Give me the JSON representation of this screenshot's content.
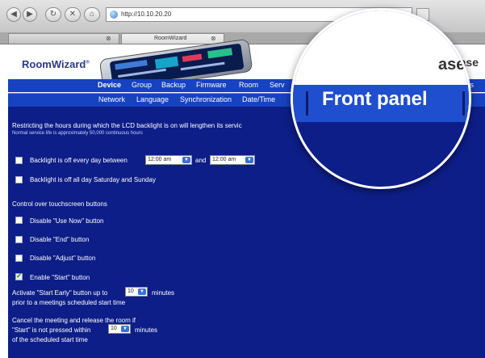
{
  "browser": {
    "url": "http://10.10.20.20",
    "tab_active": "RoomWizard"
  },
  "header": {
    "logo_text": "RoomWizard",
    "logo_mark": "®",
    "release_text": "ase"
  },
  "menu_primary": [
    {
      "label": "Device",
      "active": true
    },
    {
      "label": "Group"
    },
    {
      "label": "Backup"
    },
    {
      "label": "Firmware"
    },
    {
      "label": "Room"
    },
    {
      "label": "Serv"
    },
    {
      "label": "tions"
    }
  ],
  "menu_secondary": [
    {
      "label": "Network"
    },
    {
      "label": "Language"
    },
    {
      "label": "Synchronization"
    },
    {
      "label": "Date/Time"
    }
  ],
  "content": {
    "intro": "Restricting the hours during which the LCD backlight is on will lengthen its servic",
    "intro_note": "Normal service life is approximately 50,000 continuous hours",
    "backlight_daily": {
      "label": "Backlight is off every day between",
      "checked": false,
      "from": "12:00 am",
      "and": "and",
      "to": "12:00 am"
    },
    "backlight_weekend": {
      "label": "Backlight is off all day Saturday and Sunday",
      "checked": false
    },
    "touch_heading": "Control over touchscreen buttons",
    "buttons": [
      {
        "label": "Disable \"Use Now\" button",
        "checked": false
      },
      {
        "label": "Disable \"End\" button",
        "checked": false
      },
      {
        "label": "Disable \"Adjust\" button",
        "checked": false
      },
      {
        "label": "Enable \"Start\" button",
        "checked": true
      }
    ],
    "start_early": {
      "line1_pre": "Activate \"Start Early\" button up to",
      "value": "10",
      "line1_post": "minutes",
      "line2": "prior to a meetings scheduled start time"
    },
    "cancel": {
      "line1": "Cancel the meeting and release the room if",
      "line2_pre": "\"Start\" is not pressed within",
      "value": "10",
      "line2_post": "minutes",
      "line3": "of the scheduled start time"
    }
  },
  "magnifier": {
    "label": "Front panel",
    "release_text": "ase"
  },
  "colors": {
    "menu_blue": "#1742c0",
    "content_navy": "#0d1e88",
    "logo_navy": "#2a3a8c"
  }
}
